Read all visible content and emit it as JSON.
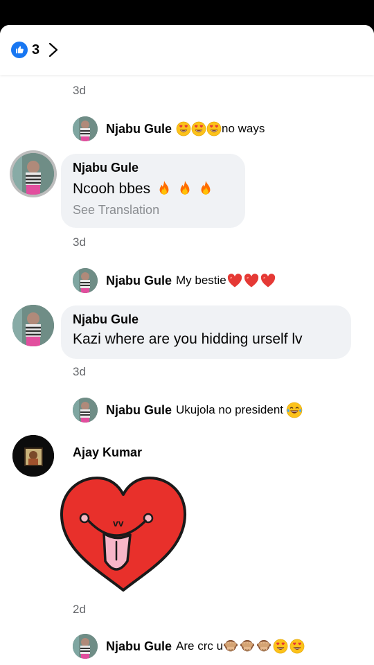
{
  "header": {
    "like_count": "3"
  },
  "thread": [
    {
      "timestamp": "3d"
    },
    {
      "reply": {
        "name": "Njabu Gule",
        "text": "no ways",
        "emojis": [
          "heart-eyes",
          "heart-eyes",
          "heart-eyes"
        ]
      }
    },
    {
      "comment": {
        "name": "Njabu Gule",
        "text": "Ncooh bbes",
        "emojis": [
          "fire",
          "fire",
          "fire"
        ],
        "translation_link": "See Translation",
        "timestamp": "3d"
      }
    },
    {
      "reply": {
        "name": "Njabu Gule",
        "text": "My bestie",
        "emojis": [
          "red-heart",
          "red-heart",
          "red-heart"
        ]
      }
    },
    {
      "comment": {
        "name": "Njabu Gule",
        "text": "Kazi where are you hidding urself lv",
        "timestamp": "3d"
      }
    },
    {
      "reply": {
        "name": "Njabu Gule",
        "text": "Ukujola no president",
        "emojis": [
          "tears-of-joy"
        ]
      }
    },
    {
      "comment": {
        "name": "Ajay Kumar",
        "sticker": "heart-tongue-sticker",
        "sticker_label": "vv",
        "timestamp": "2d"
      }
    },
    {
      "reply": {
        "name": "Njabu Gule",
        "text": "Are crc u",
        "emojis": [
          "see-no-evil-monkey",
          "see-no-evil-monkey",
          "see-no-evil-monkey",
          "heart-eyes",
          "heart-eyes"
        ]
      }
    }
  ],
  "colors": {
    "accent": "#1877f2",
    "bubble": "#f0f2f5",
    "muted_text": "#65676b",
    "sticker_red": "#e8302b"
  }
}
